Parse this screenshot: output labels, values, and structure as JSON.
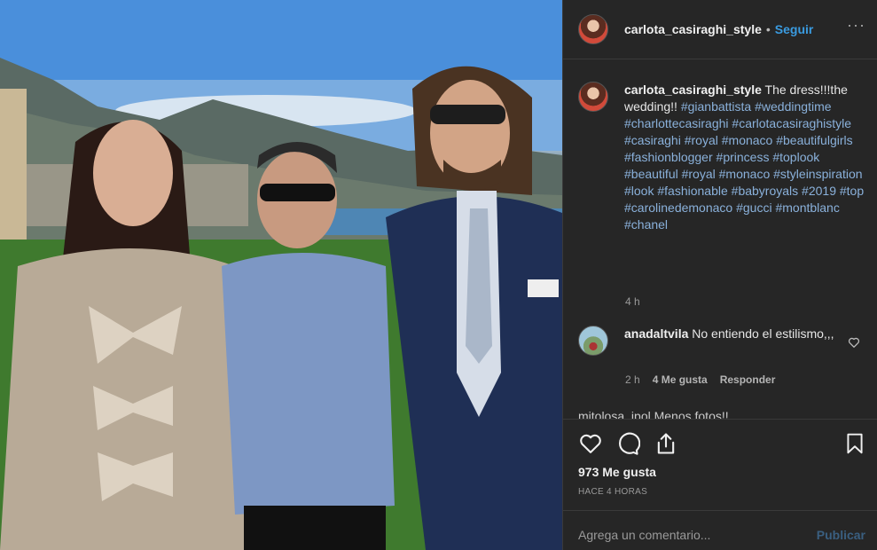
{
  "post": {
    "username": "carlota_casiraghi_style",
    "separator": "•",
    "follow_label": "Seguir",
    "more_label": "···"
  },
  "caption": {
    "username": "carlota_casiraghi_style",
    "text": "The dress!!!the wedding!!",
    "hashtags": [
      "#gianbattista",
      "#weddingtime",
      "#charlottecasiraghi",
      "#carlotacasiraghistyle",
      "#casiraghi",
      "#royal",
      "#monaco",
      "#beautifulgirls",
      "#fashionblogger",
      "#princess",
      "#toplook",
      "#beautiful",
      "#royal",
      "#monaco",
      "#styleinspiration",
      "#look",
      "#fashionable",
      "#babyroyals",
      "#2019",
      "#top",
      "#carolinedemonaco",
      "#gucci",
      "#montblanc",
      "#chanel"
    ],
    "time": "4 h"
  },
  "comment": {
    "username": "anadaltvila",
    "text": "No entiendo el estilismo,,,",
    "time": "2 h",
    "likes": "4 Me gusta",
    "reply_label": "Responder"
  },
  "peek_comment": "mjtolosa_ipol Menos fotos!!",
  "actions": {
    "likes_count": "973 Me gusta",
    "time_ago": "HACE 4 HORAS"
  },
  "add_comment": {
    "placeholder": "Agrega un comentario...",
    "post_label": "Publicar"
  },
  "icons": [
    "like-icon",
    "comment-icon",
    "share-icon",
    "save-icon",
    "more-icon"
  ],
  "colors": {
    "link": "#3a9be0",
    "hashtag": "#8ab1db",
    "background": "#262626"
  }
}
